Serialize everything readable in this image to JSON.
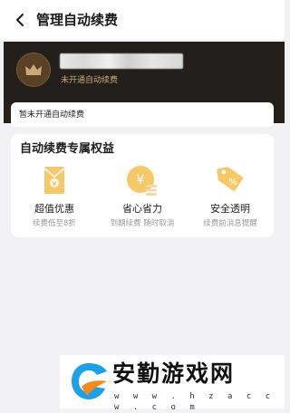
{
  "header": {
    "title": "管理自动续费"
  },
  "account": {
    "status": "未开通自动续费"
  },
  "notice": {
    "text": "暂未开通自动续费"
  },
  "benefits": {
    "title": "自动续费专属权益",
    "items": [
      {
        "label": "超值优惠",
        "desc": "续费低至8折",
        "icon": "envelope-gift-icon"
      },
      {
        "label": "省心省力",
        "desc": "到期续费 随时取消",
        "icon": "yen-coin-icon"
      },
      {
        "label": "安全透明",
        "desc": "续费前消息提醒",
        "icon": "percent-tag-icon"
      }
    ]
  },
  "colors": {
    "hero_bg": "#231f1c",
    "gold": "#c9a878",
    "icon_gold": "#f5c868"
  },
  "watermark": {
    "text": "安勤游戏网",
    "url": "w w w . h z a c c w . c o m"
  }
}
